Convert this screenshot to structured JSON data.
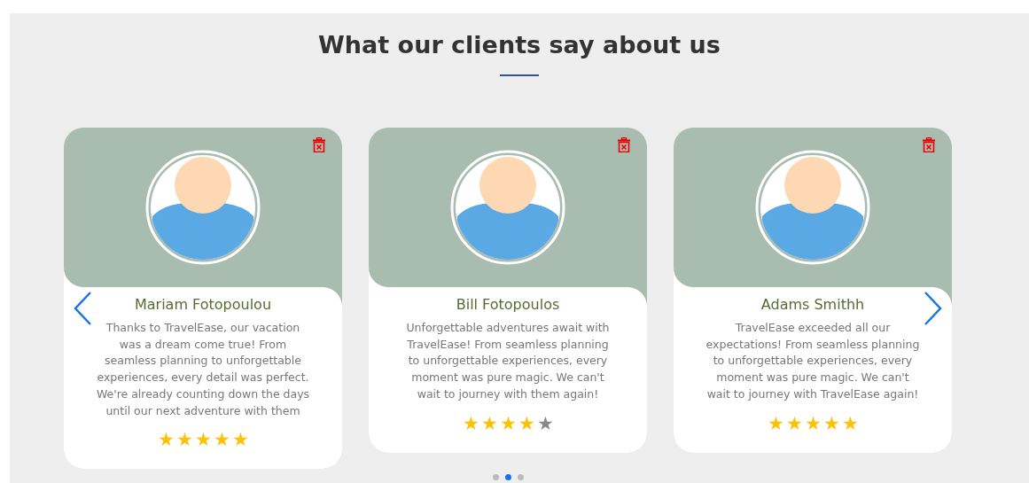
{
  "title": "What our clients say about us",
  "testimonials": [
    {
      "name": "Mariam Fotopoulou",
      "text": "Thanks to TravelEase, our vacation was a dream come true! From seamless planning to unforgettable experiences, every detail was perfect. We're already counting down the days until our next adventure with them",
      "stars": 5
    },
    {
      "name": "Bill Fotopoulos",
      "text": "Unforgettable adventures await with TravelEase! From seamless planning to unforgettable experiences, every moment was pure magic. We can't wait to journey with them again!",
      "stars": 4
    },
    {
      "name": "Adams Smithh",
      "text": "TravelEase exceeded all our expectations! From seamless planning to unforgettable experiences, every moment was pure magic. We can't wait to journey with TravelEase again!",
      "stars": 5
    }
  ],
  "pagination": [
    {
      "selected": false
    },
    {
      "selected": true
    },
    {
      "selected": false
    }
  ]
}
